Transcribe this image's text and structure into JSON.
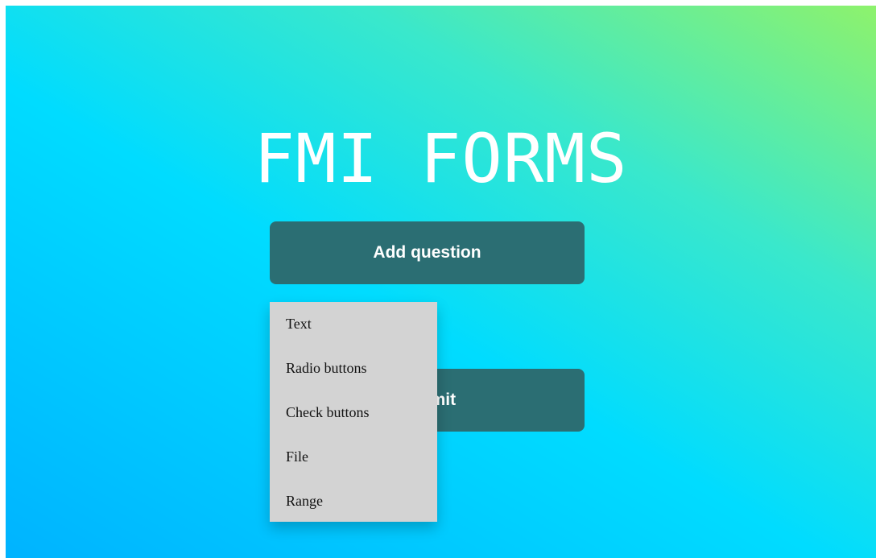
{
  "page": {
    "title": "FMI FORMS"
  },
  "buttons": {
    "add_question": "Add question",
    "submit": "Submit"
  },
  "dropdown": {
    "items": [
      {
        "label": "Text"
      },
      {
        "label": "Radio buttons"
      },
      {
        "label": "Check buttons"
      },
      {
        "label": "File"
      },
      {
        "label": "Range"
      }
    ]
  },
  "colors": {
    "button_bg": "#2b6e73",
    "dropdown_bg": "#d3d3d3",
    "gradient_start": "#00b3ff",
    "gradient_mid": "#00dcff",
    "gradient_end": "#8ef26c"
  }
}
